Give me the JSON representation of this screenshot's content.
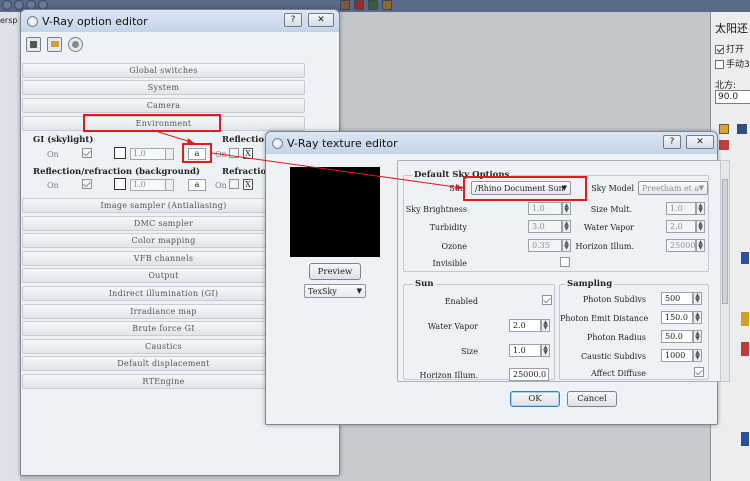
{
  "background": {
    "left_tab_label": "ersp",
    "sun_panel": {
      "title": "太阳还",
      "checkbox_on_label": "打开",
      "checkbox_manual_label": "手动3",
      "north_label": "北方:",
      "north_value": "90.0"
    }
  },
  "option_editor": {
    "title": "V-Ray option editor",
    "help_label": "?",
    "close_label": "✕",
    "sections_top": [
      "Global switches",
      "System",
      "Camera",
      "Environment"
    ],
    "env": {
      "gi_label": "GI (skylight)",
      "reflection_label": "Reflectio",
      "refl_refr_label": "Reflection/refraction (background)",
      "refraction_label": "Refractio",
      "on_label": "On",
      "gi_multiplier": "1.0",
      "bg_multiplier": "1.0",
      "map_button_label": "a",
      "x_label": "X"
    },
    "sections_bottom": [
      "Image sampler (Antialiasing)",
      "DMC sampler",
      "Color mapping",
      "VFB channels",
      "Output",
      "Indirect illumination (GI)",
      "Irradiance map",
      "Brute force GI",
      "Caustics",
      "Default displacement",
      "RTEngine"
    ]
  },
  "texture_editor": {
    "title": "V-Ray texture editor",
    "help_label": "?",
    "close_label": "✕",
    "preview_button": "Preview",
    "texture_type": "TexSky",
    "default_sky": {
      "group_title": "Default Sky Options",
      "sun_label": "Sun",
      "sun_value": "/Rhino Document Sun",
      "sky_model_label": "Sky Model",
      "sky_model_value": "Preetham et a",
      "sky_brightness_label": "Sky Brightness",
      "sky_brightness_value": "1.0",
      "size_mult_label": "Size Mult.",
      "size_mult_value": "1.0",
      "turbidity_label": "Turbidity",
      "turbidity_value": "3.0",
      "water_vapor_label": "Water Vapor",
      "water_vapor_value": "2.0",
      "ozone_label": "Ozone",
      "ozone_value": "0.35",
      "horizon_illum_label": "Horizon Illum.",
      "horizon_illum_value": "25000.0",
      "invisible_label": "Invisible"
    },
    "sun_group": {
      "group_title": "Sun",
      "enabled_label": "Enabled",
      "water_vapor_label": "Water Vapor",
      "water_vapor_value": "2.0",
      "size_label": "Size",
      "size_value": "1.0",
      "horizon_illum_label": "Horizon Illum.",
      "horizon_illum_value": "25000.0"
    },
    "sampling_group": {
      "group_title": "Sampling",
      "photon_subdivs_label": "Photon Subdivs",
      "photon_subdivs_value": "500",
      "photon_emit_distance_label": "Photon Emit Distance",
      "photon_emit_distance_value": "150.0",
      "photon_radius_label": "Photon Radius",
      "photon_radius_value": "50.0",
      "caustic_subdivs_label": "Caustic Subdivs",
      "caustic_subdivs_value": "1000",
      "affect_diffuse_label": "Affect Diffuse"
    },
    "ok_label": "OK",
    "cancel_label": "Cancel"
  },
  "colors": {
    "highlight_red": "#e01c1c",
    "title_bar": "#c4d4e8",
    "window_bg": "#eef2f7"
  }
}
